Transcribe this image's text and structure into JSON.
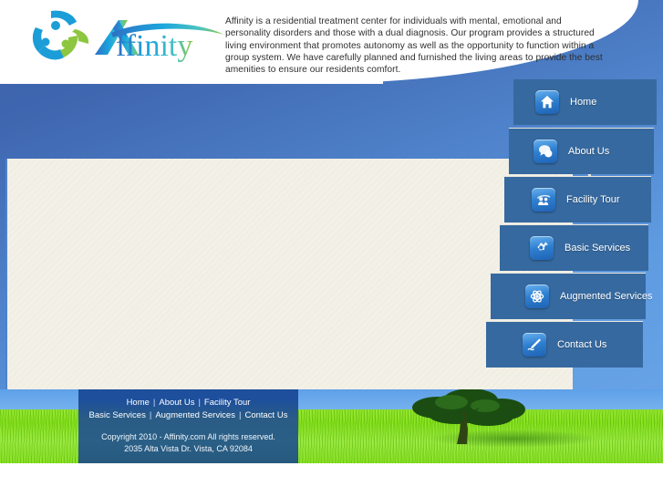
{
  "site": {
    "brand_name": "Affinity",
    "logo_icon": "people-swirl-logo-icon",
    "intro_text": "Affinity is a residential treatment center for individuals with mental, emotional and personality disorders and those with a dual diagnosis. Our program provides a structured living environment that promotes autonomy as well as the opportunity to function within a group system. We have carefully planned and furnished the living areas to provide the best amenities to ensure our residents comfort."
  },
  "colors": {
    "header_blue": "#3a61ab",
    "accent_blue": "#4d80c8",
    "nav_panel": "#36699f",
    "content_cream": "#f1eee4",
    "footer_blue": "#1d4f9c",
    "grass_green": "#8fe22a"
  },
  "nav": {
    "items": [
      {
        "label": "Home",
        "icon": "home-icon"
      },
      {
        "label": "About Us",
        "icon": "speech-bubbles-icon"
      },
      {
        "label": "Facility Tour",
        "icon": "people-group-icon"
      },
      {
        "label": "Basic Services",
        "icon": "gear-icon"
      },
      {
        "label": "Augmented Services",
        "icon": "atom-icon"
      },
      {
        "label": "Contact Us",
        "icon": "pen-write-icon"
      }
    ]
  },
  "footer": {
    "links_row1": [
      "Home",
      "About Us",
      "Facility Tour"
    ],
    "links_row2": [
      "Basic Services",
      "Augmented Services",
      "Contact Us"
    ],
    "separator": "|",
    "copyright": "Copyright 2010 - Affinity.com All rights reserved.",
    "address": "2035 Alta Vista Dr. Vista, CA 92084"
  },
  "hero": {
    "image_alt": "tree-in-grass-field-image"
  }
}
